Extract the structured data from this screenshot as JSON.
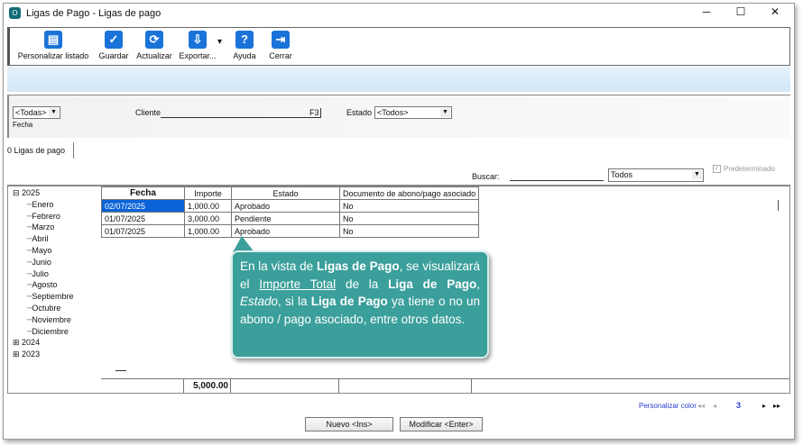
{
  "window": {
    "title": "Ligas de Pago - Ligas de pago",
    "minimize": "─",
    "maximize": "☐",
    "close": "✕"
  },
  "toolbar": [
    {
      "label": "Personalizar listado",
      "icon": "▤"
    },
    {
      "label": "Guardar",
      "icon": "✓"
    },
    {
      "label": "Actualizar",
      "icon": "⟳"
    },
    {
      "label": "Exportar...",
      "icon": "⇩"
    },
    {
      "label": "Ayuda",
      "icon": "?"
    },
    {
      "label": "Cerrar",
      "icon": "⇥"
    }
  ],
  "export_arrow": "▾",
  "filters": {
    "fecha_value": "<Todas>",
    "fecha_label": "Fecha",
    "cliente_label": "Cliente",
    "cliente_value": "",
    "f3": "F3",
    "estado_label": "Estado",
    "estado_value": "<Todos>"
  },
  "tab": "0 Ligas de pago",
  "search": {
    "label": "Buscar:",
    "value": "",
    "scope": "Todos",
    "predeterminado": "Predeterminado"
  },
  "tree": {
    "years": [
      {
        "label": "2025",
        "expanded": true,
        "months": [
          "Enero",
          "Febrero",
          "Marzo",
          "Abril",
          "Mayo",
          "Junio",
          "Julio",
          "Agosto",
          "Septiembre",
          "Octubre",
          "Noviembre",
          "Diciembre"
        ]
      },
      {
        "label": "2024"
      },
      {
        "label": "2023"
      }
    ]
  },
  "table": {
    "headers": [
      "Fecha",
      "Importe",
      "Estado",
      "Documento de abono/pago asociado"
    ],
    "rows": [
      [
        "02/07/2025",
        "1,000.00",
        "Aprobado",
        "No"
      ],
      [
        "01/07/2025",
        "3,000.00",
        "Pendiente",
        "No"
      ],
      [
        "01/07/2025",
        "1,000.00",
        "Aprobado",
        "No"
      ]
    ],
    "total": "5,000.00"
  },
  "callout": {
    "p1": "En la vista de ",
    "b1": "Ligas de Pago",
    "p2": ", se visualizará el ",
    "u1": "Importe Total",
    "p3": " de la ",
    "b2": "Liga de Pago",
    "p4": ", ",
    "i1": "Estado",
    "p5": ", si la ",
    "b3": "Liga de Pago",
    "p6": " ya tiene o no un abono / pago asociado, entre otros datos."
  },
  "footer": {
    "personalizar_color": "Personalizar color",
    "first": "◂◂",
    "prev": "◂",
    "page": "3",
    "next": "▸",
    "last": "▸▸",
    "nuevo": "Nuevo <Ins>",
    "modificar": "Modificar <Enter>"
  },
  "colors": {
    "accent": "#1a73d9",
    "callout": "#3b9f9b",
    "link": "#2a3fd0"
  }
}
